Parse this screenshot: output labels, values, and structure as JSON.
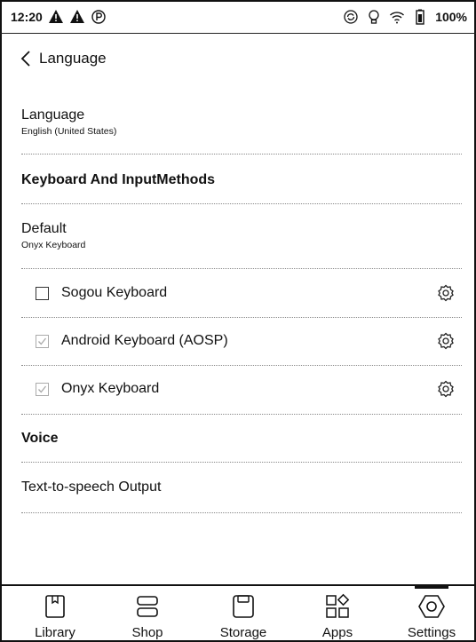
{
  "status_bar": {
    "time": "12:20",
    "battery": "100%",
    "icons": [
      "alert-icon",
      "alert-icon",
      "parking-icon",
      "sync-icon",
      "bulb-icon",
      "wifi-icon",
      "battery-icon"
    ]
  },
  "header": {
    "title": "Language"
  },
  "language": {
    "title": "Language",
    "value": "English (United States)"
  },
  "keyboard_section": {
    "heading": "Keyboard And InputMethods"
  },
  "default_keyboard": {
    "title": "Default",
    "value": "Onyx Keyboard"
  },
  "keyboards": [
    {
      "label": "Sogou Keyboard",
      "checked": false
    },
    {
      "label": "Android Keyboard (AOSP)",
      "checked": true
    },
    {
      "label": "Onyx Keyboard",
      "checked": true
    }
  ],
  "voice_section": {
    "heading": "Voice"
  },
  "tts": {
    "title": "Text-to-speech Output"
  },
  "bottom_nav": {
    "items": [
      {
        "label": "Library",
        "icon": "book-icon"
      },
      {
        "label": "Shop",
        "icon": "shop-icon"
      },
      {
        "label": "Storage",
        "icon": "storage-icon"
      },
      {
        "label": "Apps",
        "icon": "apps-icon"
      },
      {
        "label": "Settings",
        "icon": "settings-icon"
      }
    ],
    "active": "Settings"
  }
}
